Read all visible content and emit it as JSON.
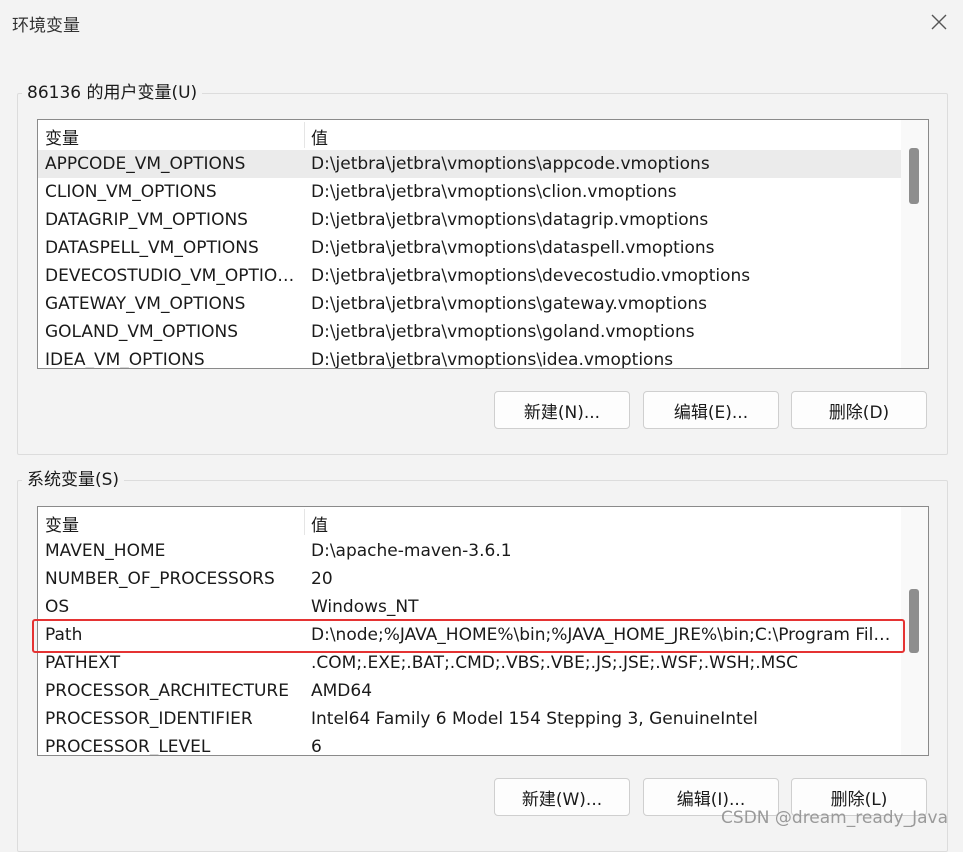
{
  "window": {
    "title": "环境变量"
  },
  "user_section": {
    "label": "86136 的用户变量(U)",
    "col_name": "变量",
    "col_value": "值",
    "rows": [
      {
        "name": "APPCODE_VM_OPTIONS",
        "value": "D:\\jetbra\\jetbra\\vmoptions\\appcode.vmoptions"
      },
      {
        "name": "CLION_VM_OPTIONS",
        "value": "D:\\jetbra\\jetbra\\vmoptions\\clion.vmoptions"
      },
      {
        "name": "DATAGRIP_VM_OPTIONS",
        "value": "D:\\jetbra\\jetbra\\vmoptions\\datagrip.vmoptions"
      },
      {
        "name": "DATASPELL_VM_OPTIONS",
        "value": "D:\\jetbra\\jetbra\\vmoptions\\dataspell.vmoptions"
      },
      {
        "name": "DEVECOSTUDIO_VM_OPTIONS",
        "value": "D:\\jetbra\\jetbra\\vmoptions\\devecostudio.vmoptions"
      },
      {
        "name": "GATEWAY_VM_OPTIONS",
        "value": "D:\\jetbra\\jetbra\\vmoptions\\gateway.vmoptions"
      },
      {
        "name": "GOLAND_VM_OPTIONS",
        "value": "D:\\jetbra\\jetbra\\vmoptions\\goland.vmoptions"
      },
      {
        "name": "IDEA_VM_OPTIONS",
        "value": "D:\\jetbra\\jetbra\\vmoptions\\idea.vmoptions"
      }
    ],
    "buttons": {
      "new": "新建(N)...",
      "edit": "编辑(E)...",
      "delete": "删除(D)"
    }
  },
  "system_section": {
    "label": "系统变量(S)",
    "col_name": "变量",
    "col_value": "值",
    "rows": [
      {
        "name": "MAVEN_HOME",
        "value": "D:\\apache-maven-3.6.1"
      },
      {
        "name": "NUMBER_OF_PROCESSORS",
        "value": "20"
      },
      {
        "name": "OS",
        "value": "Windows_NT"
      },
      {
        "name": "Path",
        "value": "D:\\node;%JAVA_HOME%\\bin;%JAVA_HOME_JRE%\\bin;C:\\Program Files\\Common Files\\Oracle\\Java\\javapath"
      },
      {
        "name": "PATHEXT",
        "value": ".COM;.EXE;.BAT;.CMD;.VBS;.VBE;.JS;.JSE;.WSF;.WSH;.MSC"
      },
      {
        "name": "PROCESSOR_ARCHITECTURE",
        "value": "AMD64"
      },
      {
        "name": "PROCESSOR_IDENTIFIER",
        "value": "Intel64 Family 6 Model 154 Stepping 3, GenuineIntel"
      },
      {
        "name": "PROCESSOR_LEVEL",
        "value": "6"
      }
    ],
    "buttons": {
      "new": "新建(W)...",
      "edit": "编辑(I)...",
      "delete": "删除(L)"
    }
  },
  "watermark": "CSDN @dream_ready_Java",
  "colors": {
    "highlight": "#e53333",
    "selected_row": "#ebebeb"
  },
  "icons": {
    "close": "close-icon"
  }
}
